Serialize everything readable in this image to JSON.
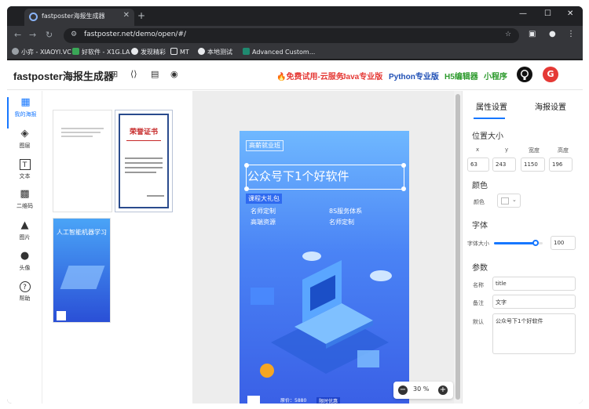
{
  "browser": {
    "tab_title": "fastposter海报生成器",
    "url": "fastposter.net/demo/open/#/",
    "bookmarks": [
      "小弈 - XIAOYI.VC",
      "好软件 - X1G.LA",
      "发现精彩",
      "MT",
      "本地测试",
      "Advanced Custom..."
    ]
  },
  "header": {
    "title": "fastposter海报生成器",
    "links": [
      {
        "label": "🔥免费试用-云服务",
        "color": "#e53935"
      },
      {
        "label": "Java专业版",
        "color": "#e53935"
      },
      {
        "label": "Python专业版",
        "color": "#1f4fb5"
      },
      {
        "label": "H5编辑器",
        "color": "#2e9b2e"
      },
      {
        "label": "小程序",
        "color": "#2e9b2e"
      }
    ]
  },
  "sidebar": {
    "items": [
      {
        "label": "我的海报",
        "icon": "layout-icon"
      },
      {
        "label": "图层",
        "icon": "layers-icon"
      },
      {
        "label": "文本",
        "icon": "text-icon"
      },
      {
        "label": "二维码",
        "icon": "qrcode-icon"
      },
      {
        "label": "图片",
        "icon": "image-icon"
      },
      {
        "label": "头像",
        "icon": "avatar-icon"
      },
      {
        "label": "帮助",
        "icon": "help-icon"
      }
    ]
  },
  "templates": {
    "cert_title": "荣誉证书",
    "ai_title": "人工智能机器学习"
  },
  "poster": {
    "badge": "高薪就业班",
    "headline": "公众号下1个好软件",
    "gift": "课程大礼包",
    "features": [
      "名师定制",
      "8S服务体系",
      "高端资源",
      "名师定制"
    ],
    "price_label": "原价：",
    "price": "5880",
    "cta": "限时优惠"
  },
  "zoom": {
    "label": "30 %"
  },
  "panel": {
    "tabs": [
      "属性设置",
      "海报设置"
    ],
    "position": {
      "title": "位置大小",
      "labels": [
        "x",
        "y",
        "宽度",
        "高度"
      ],
      "values": [
        "63",
        "243",
        "1150",
        "196"
      ]
    },
    "color": {
      "title": "颜色",
      "label": "颜色"
    },
    "font": {
      "title": "字体",
      "label": "字体大小",
      "value": "100",
      "level": 0.85
    },
    "params": {
      "title": "参数",
      "name_label": "名称",
      "name_value": "title",
      "note_label": "备注",
      "note_value": "文字",
      "default_label": "默认",
      "default_value": "公众号下1个好软件"
    }
  }
}
